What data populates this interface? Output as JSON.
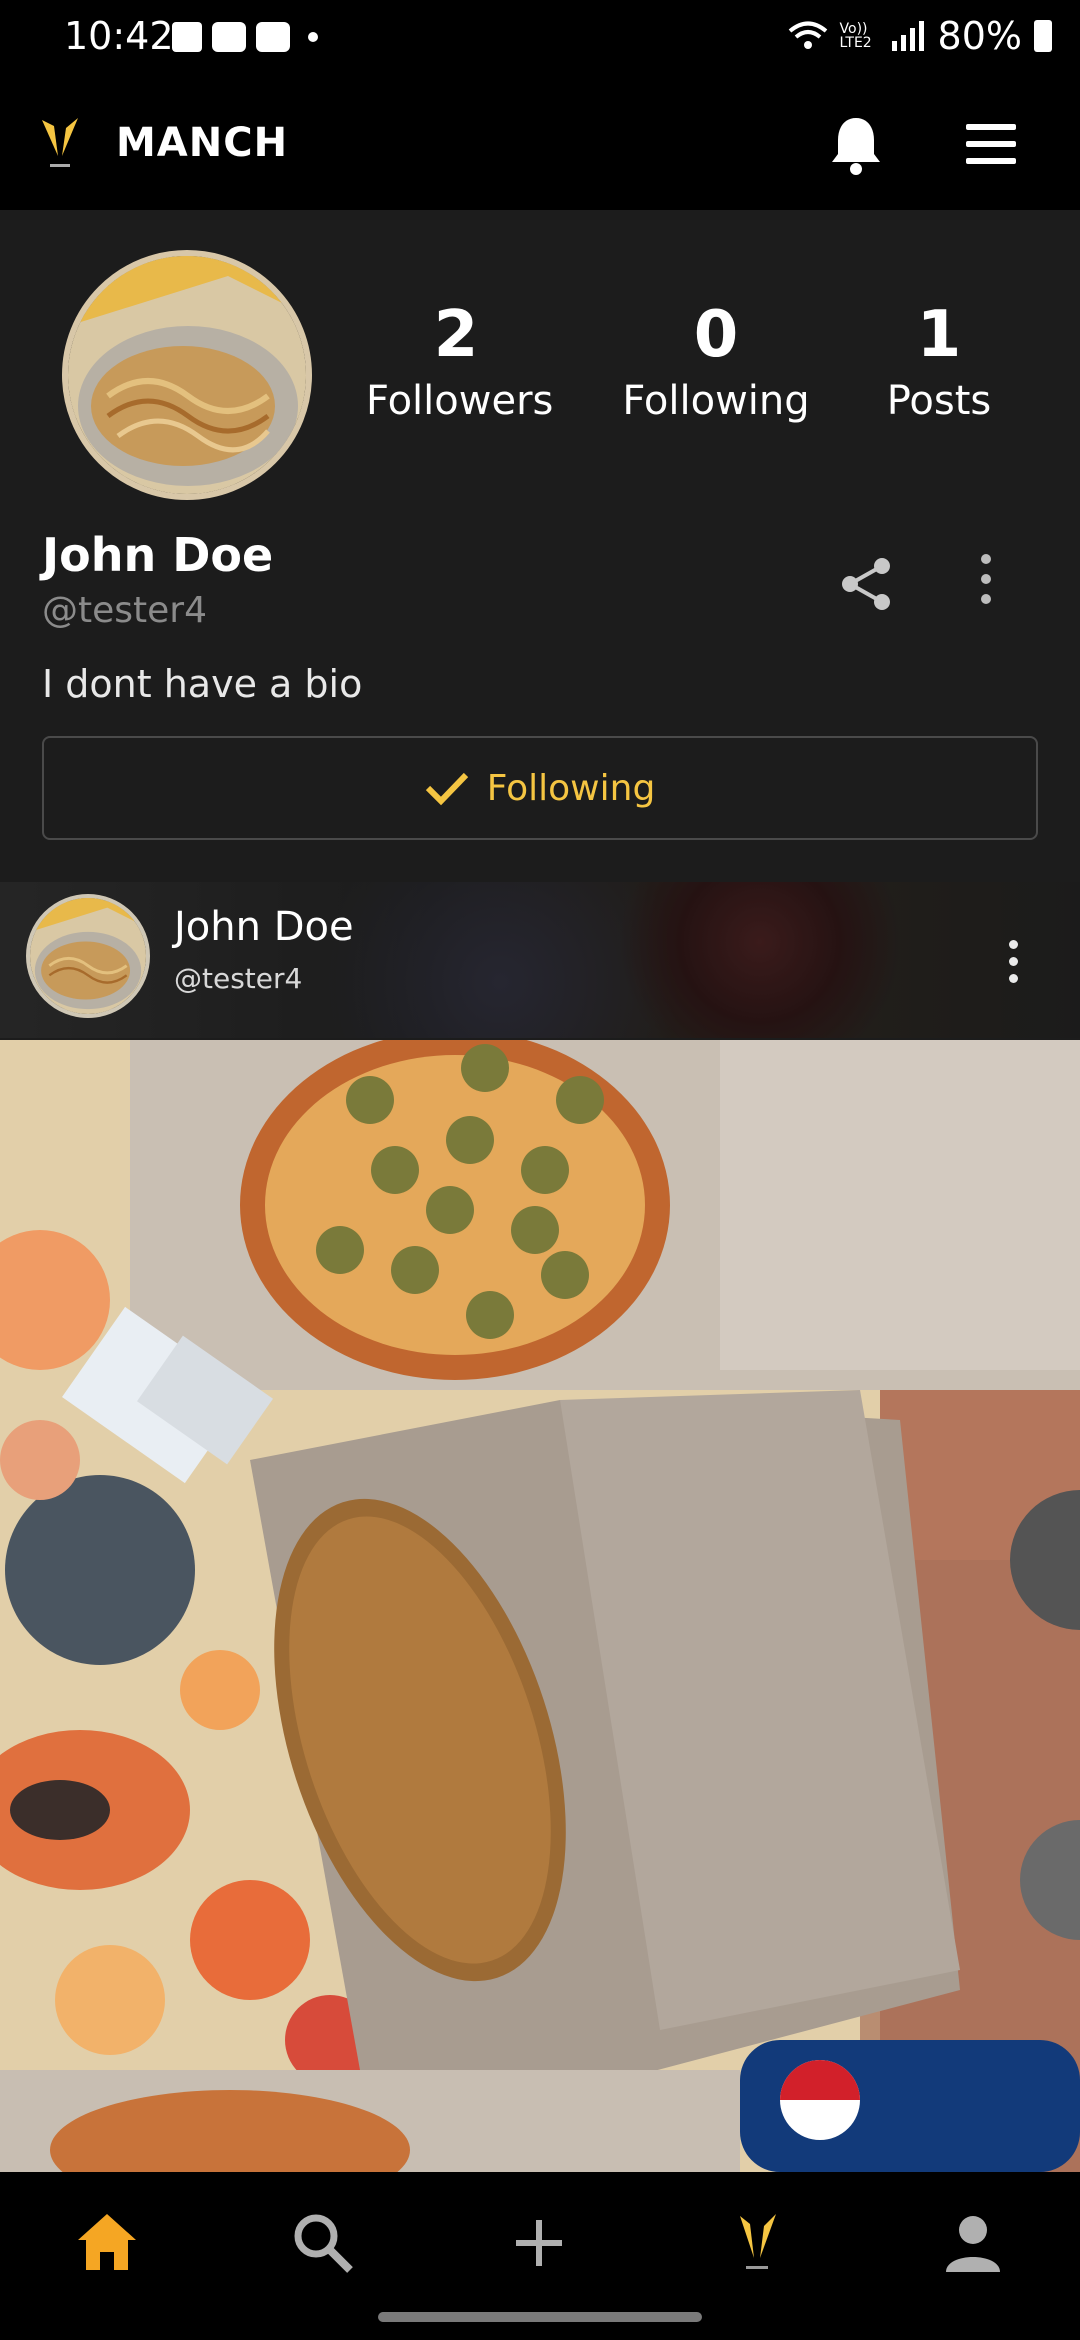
{
  "status": {
    "time": "10:42",
    "network": "Vo)) LTE2",
    "battery": "80%"
  },
  "header": {
    "title": "MANCH"
  },
  "profile": {
    "name": "John Doe",
    "handle": "@tester4",
    "bio": "I dont have a bio",
    "stats": [
      {
        "value": "2",
        "label": "Followers"
      },
      {
        "value": "0",
        "label": "Following"
      },
      {
        "value": "1",
        "label": "Posts"
      }
    ],
    "follow_button": "Following"
  },
  "post": {
    "author_name": "John Doe",
    "author_handle": "@tester4"
  },
  "bottom_nav": {
    "items": [
      "home-icon",
      "search-icon",
      "add-icon",
      "manch-logo-icon",
      "profile-icon"
    ],
    "active_color": "#f5a623"
  },
  "colors": {
    "accent": "#f5c542",
    "background": "#1c1c1c",
    "bar": "#000000"
  }
}
